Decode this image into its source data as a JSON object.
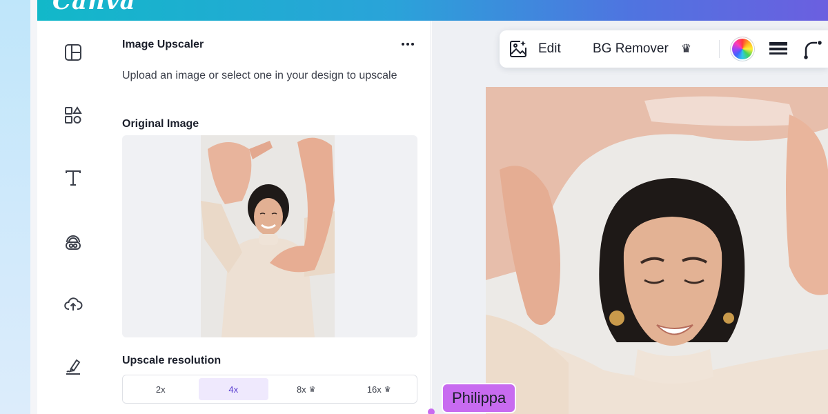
{
  "app": {
    "logo_text": "Canva"
  },
  "sidebar": {
    "icons": [
      "templates-icon",
      "elements-icon",
      "text-icon",
      "brand-icon",
      "uploads-icon",
      "draw-icon"
    ]
  },
  "panel": {
    "title": "Image Upscaler",
    "description": "Upload an image or select one in your design to upscale",
    "original_label": "Original Image",
    "resolution_label": "Upscale resolution",
    "resolution_options": [
      {
        "label": "2x",
        "pro": false,
        "selected": false
      },
      {
        "label": "4x",
        "pro": false,
        "selected": true
      },
      {
        "label": "8x",
        "pro": true,
        "selected": false
      },
      {
        "label": "16x",
        "pro": true,
        "selected": false
      }
    ],
    "crown_glyph": "♛"
  },
  "toolbar": {
    "edit_label": "Edit",
    "bg_remover_label": "BG Remover",
    "crown_glyph": "♛"
  },
  "collaborator": {
    "name": "Philippa",
    "color": "#c86bf0"
  },
  "colors": {
    "accent": "#5b3fd1",
    "selected_bg": "#efe9fd",
    "header_start": "#12b8c9",
    "header_end": "#6b5fe0"
  }
}
